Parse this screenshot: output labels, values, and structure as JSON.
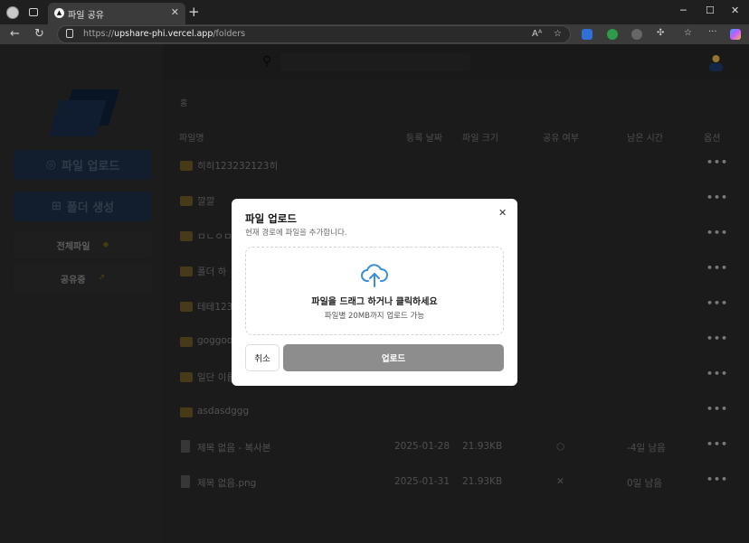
{
  "browser": {
    "tab_title": "파일 공유",
    "url_prefix": "https://",
    "url_host": "upshare-phi.vercel.app",
    "url_path": "/folders"
  },
  "sidebar": {
    "upload_label": "파일 업로드",
    "create_folder_label": "폴더 생성",
    "links": [
      {
        "label": "전체파일"
      },
      {
        "label": "공유중"
      }
    ]
  },
  "main": {
    "breadcrumb": "홈",
    "columns": {
      "name": "파일명",
      "date": "등록 날짜",
      "size": "파일 크기",
      "shared": "공유 여부",
      "remaining": "남은 시간",
      "options": "옵션"
    },
    "rows": [
      {
        "type": "folder",
        "name": "히히123232123히",
        "date": "",
        "size": "",
        "shared": "",
        "remaining": ""
      },
      {
        "type": "folder",
        "name": "깔깔",
        "date": "",
        "size": "",
        "shared": "",
        "remaining": ""
      },
      {
        "type": "folder",
        "name": "ㅁㄴㅇㅁ",
        "date": "",
        "size": "",
        "shared": "",
        "remaining": ""
      },
      {
        "type": "folder",
        "name": "폴더 하",
        "date": "",
        "size": "",
        "shared": "",
        "remaining": ""
      },
      {
        "type": "folder",
        "name": "테테123",
        "date": "",
        "size": "",
        "shared": "",
        "remaining": ""
      },
      {
        "type": "folder",
        "name": "goggoo",
        "date": "",
        "size": "",
        "shared": "",
        "remaining": ""
      },
      {
        "type": "folder",
        "name": "일단 이름",
        "date": "",
        "size": "",
        "shared": "",
        "remaining": ""
      },
      {
        "type": "folder",
        "name": "asdasdggg",
        "date": "",
        "size": "",
        "shared": "",
        "remaining": ""
      },
      {
        "type": "file",
        "name": "제목 없음 - 복사본",
        "date": "2025-01-28",
        "size": "21.93KB",
        "shared": "○",
        "remaining": "-4일 남음"
      },
      {
        "type": "file",
        "name": "제목 없음.png",
        "date": "2025-01-31",
        "size": "21.93KB",
        "shared": "✕",
        "remaining": "0일 남음"
      }
    ],
    "options_glyph": "•••"
  },
  "modal": {
    "title": "파일 업로드",
    "subtitle": "현재 경로에 파일을 추가합니다.",
    "close_glyph": "✕",
    "drop_main": "파일을 드래그 하거나 클릭하세요",
    "drop_sub": "파일별 20MB까지 업로드 가능",
    "cancel_label": "취소",
    "upload_label": "업로드"
  },
  "colors": {
    "accent_blue": "#1c2d45",
    "cloud_icon": "#3b8fd9",
    "upload_button": "#8d8d8d"
  }
}
